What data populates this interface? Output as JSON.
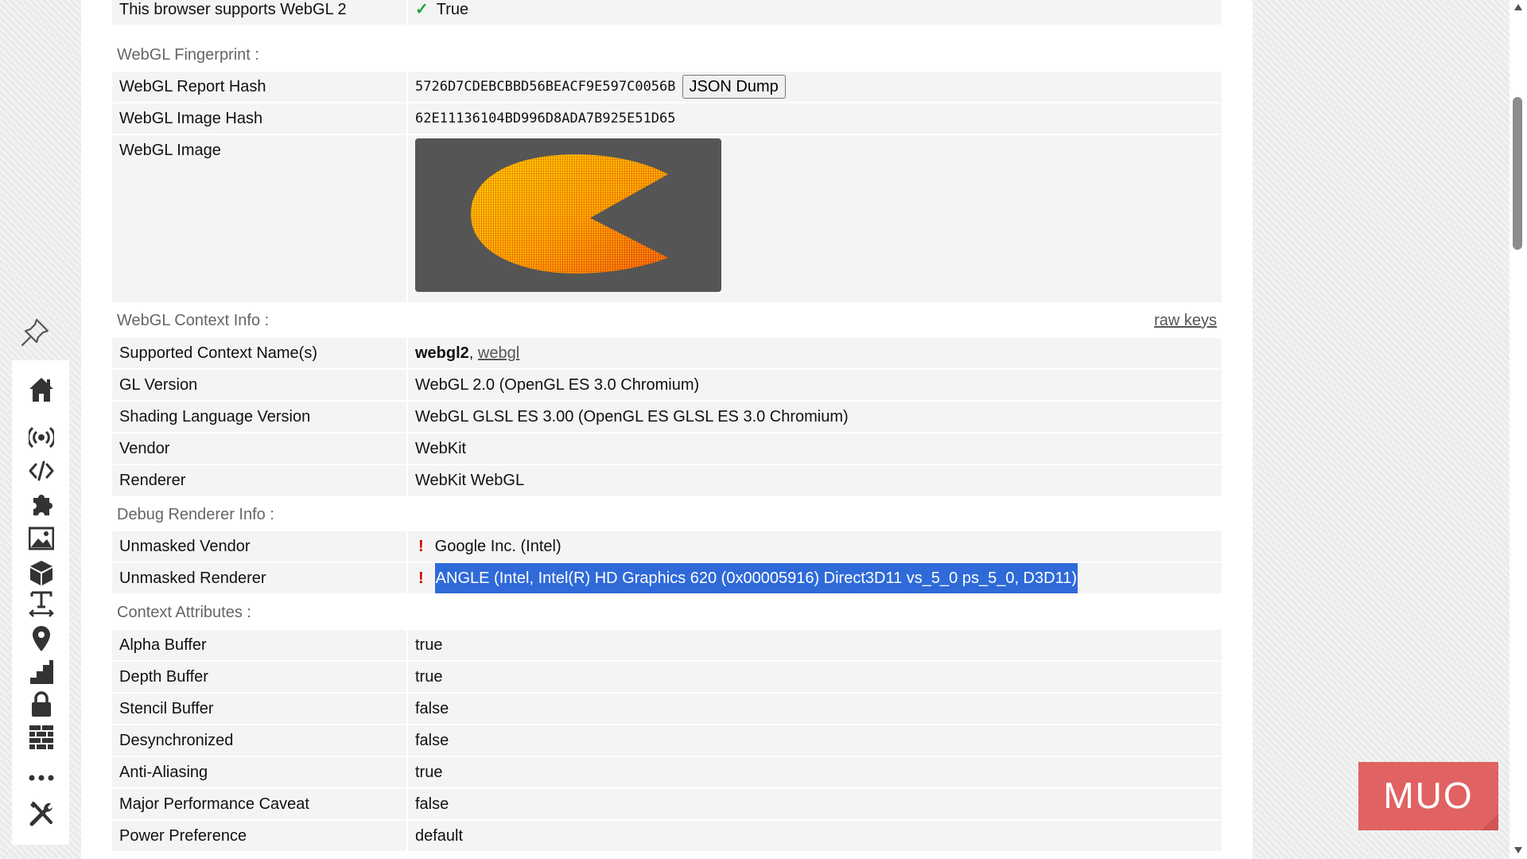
{
  "rows_top": [
    {
      "label": "This browser supports WebGL 2",
      "value": "True",
      "icon": "check-icon"
    }
  ],
  "fingerprint": {
    "section_title": "WebGL Fingerprint :",
    "report_hash_label": "WebGL Report Hash",
    "report_hash_value": "5726D7CDEBCBBD56BEACF9E597C0056B",
    "json_button": "JSON Dump",
    "image_hash_label": "WebGL Image Hash",
    "image_hash_value": "62E11136104BD996D8ADA7B925E51D65",
    "image_label": "WebGL Image"
  },
  "context_info": {
    "section_title": "WebGL Context Info :",
    "raw_keys_link": "raw keys",
    "supported_label": "Supported Context Name(s)",
    "supported_primary": "webgl2",
    "supported_separator": ", ",
    "supported_secondary": "webgl",
    "rows": [
      {
        "label": "GL Version",
        "value": "WebGL 2.0 (OpenGL ES 3.0 Chromium)"
      },
      {
        "label": "Shading Language Version",
        "value": "WebGL GLSL ES 3.00 (OpenGL ES GLSL ES 3.0 Chromium)"
      },
      {
        "label": "Vendor",
        "value": "WebKit"
      },
      {
        "label": "Renderer",
        "value": "WebKit WebGL"
      }
    ]
  },
  "debug_renderer": {
    "section_title": "Debug Renderer Info :",
    "vendor_label": "Unmasked Vendor",
    "vendor_value": "Google Inc. (Intel)",
    "renderer_label": "Unmasked Renderer",
    "renderer_value": "ANGLE (Intel, Intel(R) HD Graphics 620 (0x00005916) Direct3D11 vs_5_0 ps_5_0, D3D11)",
    "warning_mark": "!"
  },
  "context_attributes": {
    "section_title": "Context Attributes :",
    "rows": [
      {
        "label": "Alpha Buffer",
        "value": "true"
      },
      {
        "label": "Depth Buffer",
        "value": "true"
      },
      {
        "label": "Stencil Buffer",
        "value": "false"
      },
      {
        "label": "Desynchronized",
        "value": "false"
      },
      {
        "label": "Anti-Aliasing",
        "value": "true"
      },
      {
        "label": "Major Performance Caveat",
        "value": "false"
      },
      {
        "label": "Power Preference",
        "value": "default"
      }
    ]
  },
  "sidebar": {
    "items": [
      {
        "name": "home-icon"
      },
      {
        "name": "broadcast-icon"
      },
      {
        "name": "code-icon"
      },
      {
        "name": "puzzle-icon"
      },
      {
        "name": "image-icon"
      },
      {
        "name": "cube-icon"
      },
      {
        "name": "text-width-icon"
      },
      {
        "name": "location-pin-icon"
      },
      {
        "name": "stairs-icon"
      },
      {
        "name": "lock-icon"
      },
      {
        "name": "brick-wall-icon"
      },
      {
        "name": "more-dots-icon"
      },
      {
        "name": "tools-icon"
      }
    ]
  },
  "watermark": {
    "text": "MUO"
  },
  "colors": {
    "selection": "#2f6ad8",
    "check": "#1aa33a",
    "warning": "#d60000",
    "watermark": "#e05656"
  }
}
